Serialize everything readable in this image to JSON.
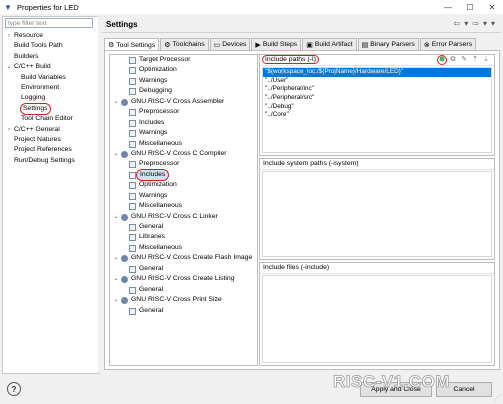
{
  "window": {
    "title": "Properties for LED",
    "controls": [
      "—",
      "☐",
      "✕"
    ]
  },
  "filter": {
    "placeholder": "type filter text"
  },
  "nav": {
    "items": [
      {
        "label": "Resource",
        "indent": 0,
        "chevron": "›"
      },
      {
        "label": "Build Tools Path",
        "indent": 0,
        "chevron": ""
      },
      {
        "label": "Builders",
        "indent": 0,
        "chevron": ""
      },
      {
        "label": "C/C++ Build",
        "indent": 0,
        "chevron": "⌄"
      },
      {
        "label": "Build Variables",
        "indent": 1,
        "chevron": ""
      },
      {
        "label": "Environment",
        "indent": 1,
        "chevron": ""
      },
      {
        "label": "Logging",
        "indent": 1,
        "chevron": ""
      },
      {
        "label": "Settings",
        "indent": 1,
        "chevron": "",
        "circled": true
      },
      {
        "label": "Tool Chain Editor",
        "indent": 1,
        "chevron": ""
      },
      {
        "label": "C/C++ General",
        "indent": 0,
        "chevron": "›"
      },
      {
        "label": "Project Natures",
        "indent": 0,
        "chevron": ""
      },
      {
        "label": "Project References",
        "indent": 0,
        "chevron": ""
      },
      {
        "label": "Run/Debug Settings",
        "indent": 0,
        "chevron": ""
      }
    ]
  },
  "header": {
    "title": "Settings",
    "nav_arrows": [
      "⇦",
      "▾",
      "⇨",
      "▾",
      "▾"
    ]
  },
  "tabs": [
    {
      "label": "Tool Settings",
      "icon": "⚙",
      "active": true
    },
    {
      "label": "Toolchains",
      "icon": "⚙",
      "active": false
    },
    {
      "label": "Devices",
      "icon": "▭",
      "active": false
    },
    {
      "label": "Build Steps",
      "icon": "▶",
      "active": false
    },
    {
      "label": "Build Artifact",
      "icon": "▣",
      "active": false
    },
    {
      "label": "Binary Parsers",
      "icon": "▤",
      "active": false
    },
    {
      "label": "Error Parsers",
      "icon": "⊗",
      "active": false
    }
  ],
  "tool_tree": [
    {
      "label": "Target Processor",
      "indent": 1,
      "icon": "page",
      "chevron": ""
    },
    {
      "label": "Optimization",
      "indent": 1,
      "icon": "page",
      "chevron": ""
    },
    {
      "label": "Warnings",
      "indent": 1,
      "icon": "page",
      "chevron": ""
    },
    {
      "label": "Debugging",
      "indent": 1,
      "icon": "page",
      "chevron": ""
    },
    {
      "label": "GNU RISC-V Cross Assembler",
      "indent": 0,
      "icon": "gear",
      "chevron": "⌄"
    },
    {
      "label": "Preprocessor",
      "indent": 1,
      "icon": "page",
      "chevron": ""
    },
    {
      "label": "Includes",
      "indent": 1,
      "icon": "page",
      "chevron": ""
    },
    {
      "label": "Warnings",
      "indent": 1,
      "icon": "page",
      "chevron": ""
    },
    {
      "label": "Miscellaneous",
      "indent": 1,
      "icon": "page",
      "chevron": ""
    },
    {
      "label": "GNU RISC-V Cross C Compiler",
      "indent": 0,
      "icon": "gear",
      "chevron": "⌄"
    },
    {
      "label": "Preprocessor",
      "indent": 1,
      "icon": "page",
      "chevron": ""
    },
    {
      "label": "Includes",
      "indent": 1,
      "icon": "page",
      "chevron": "",
      "selected": true,
      "circled": true
    },
    {
      "label": "Optimization",
      "indent": 1,
      "icon": "page",
      "chevron": ""
    },
    {
      "label": "Warnings",
      "indent": 1,
      "icon": "page",
      "chevron": ""
    },
    {
      "label": "Miscellaneous",
      "indent": 1,
      "icon": "page",
      "chevron": ""
    },
    {
      "label": "GNU RISC-V Cross C Linker",
      "indent": 0,
      "icon": "gear",
      "chevron": "⌄"
    },
    {
      "label": "General",
      "indent": 1,
      "icon": "page",
      "chevron": ""
    },
    {
      "label": "Libraries",
      "indent": 1,
      "icon": "page",
      "chevron": ""
    },
    {
      "label": "Miscellaneous",
      "indent": 1,
      "icon": "page",
      "chevron": ""
    },
    {
      "label": "GNU RISC-V Cross Create Flash Image",
      "indent": 0,
      "icon": "gear",
      "chevron": "⌄"
    },
    {
      "label": "General",
      "indent": 1,
      "icon": "page",
      "chevron": ""
    },
    {
      "label": "GNU RISC-V Cross Create Listing",
      "indent": 0,
      "icon": "gear",
      "chevron": "⌄"
    },
    {
      "label": "General",
      "indent": 1,
      "icon": "page",
      "chevron": ""
    },
    {
      "label": "GNU RISC-V Cross Print Size",
      "indent": 0,
      "icon": "gear",
      "chevron": "⌄"
    },
    {
      "label": "General",
      "indent": 1,
      "icon": "page",
      "chevron": ""
    }
  ],
  "include_paths": {
    "title": "Include paths (-I)",
    "paths": [
      "\"${workspace_loc:/${ProjName}/Hardware/LED}\"",
      "\"../User\"",
      "\"../Peripheral/inc\"",
      "\"../Peripheral/src\"",
      "\"../Debug\"",
      "\"../Core\""
    ],
    "tool_icons": [
      "add-icon",
      "copy-icon",
      "edit-icon",
      "move-up-icon",
      "move-down-icon"
    ]
  },
  "include_system_paths": {
    "title": "Include system paths (-isystem)"
  },
  "include_files": {
    "title": "Include files (-include)"
  },
  "bottom": {
    "help": "?",
    "buttons": [
      "Apply and Close",
      "Cancel"
    ],
    "watermark": "RISC-V1.COM"
  },
  "colors": {
    "accent_circle": "#d62020",
    "selection": "#0078d7"
  }
}
